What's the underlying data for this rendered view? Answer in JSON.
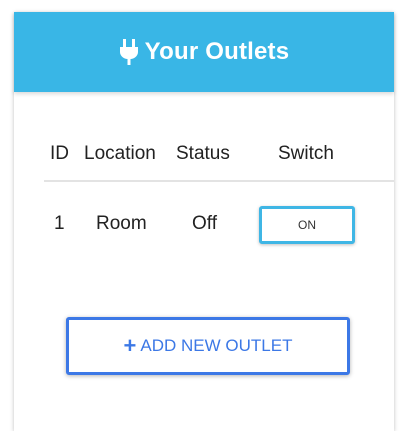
{
  "header": {
    "icon": "plug-icon",
    "title": "Your Outlets",
    "background_color": "#39b6e6"
  },
  "table": {
    "columns": [
      "ID",
      "Location",
      "Status",
      "Switch"
    ],
    "rows": [
      {
        "id": "1",
        "location": "Room",
        "status": "Off",
        "switch_label": "ON"
      }
    ]
  },
  "add_button": {
    "icon": "plus-icon",
    "icon_glyph": "+",
    "label": "ADD NEW OUTLET",
    "color": "#3c78e6"
  }
}
